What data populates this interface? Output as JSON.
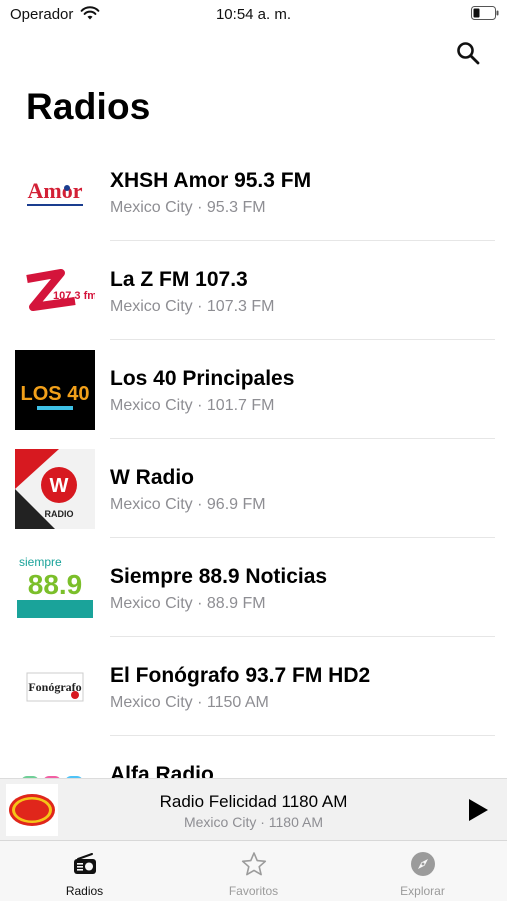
{
  "status_bar": {
    "carrier": "Operador",
    "time": "10:54 a. m."
  },
  "header": {
    "title": "Radios"
  },
  "stations": [
    {
      "name": "XHSH Amor 95.3 FM",
      "subtitle": "Mexico City · 95.3 FM",
      "logo_text": "Amor"
    },
    {
      "name": "La Z FM 107.3",
      "subtitle": "Mexico City · 107.3 FM",
      "logo_text": "107.3 fm"
    },
    {
      "name": "Los 40 Principales",
      "subtitle": "Mexico City · 101.7 FM",
      "logo_text": "LOS 40"
    },
    {
      "name": "W Radio",
      "subtitle": "Mexico City · 96.9 FM",
      "logo_text": "RADIO"
    },
    {
      "name": "Siempre 88.9 Noticias",
      "subtitle": "Mexico City · 88.9 FM",
      "logo_text": "88.9"
    },
    {
      "name": "El Fonógrafo 93.7 FM HD2",
      "subtitle": "Mexico City · 1150 AM",
      "logo_text": "Fonógrafo"
    },
    {
      "name": "Alfa Radio",
      "subtitle": "",
      "logo_text": ""
    }
  ],
  "now_playing": {
    "title": "Radio Felicidad 1180 AM",
    "subtitle": "Mexico City · 1180 AM"
  },
  "tabs": [
    {
      "label": "Radios",
      "icon": "radio-icon",
      "active": true
    },
    {
      "label": "Favoritos",
      "icon": "star-icon",
      "active": false
    },
    {
      "label": "Explorar",
      "icon": "compass-icon",
      "active": false
    }
  ],
  "colors": {
    "accent": "#111111",
    "secondary_text": "#8e8e93",
    "inactive_tab": "#9b9b9b"
  }
}
